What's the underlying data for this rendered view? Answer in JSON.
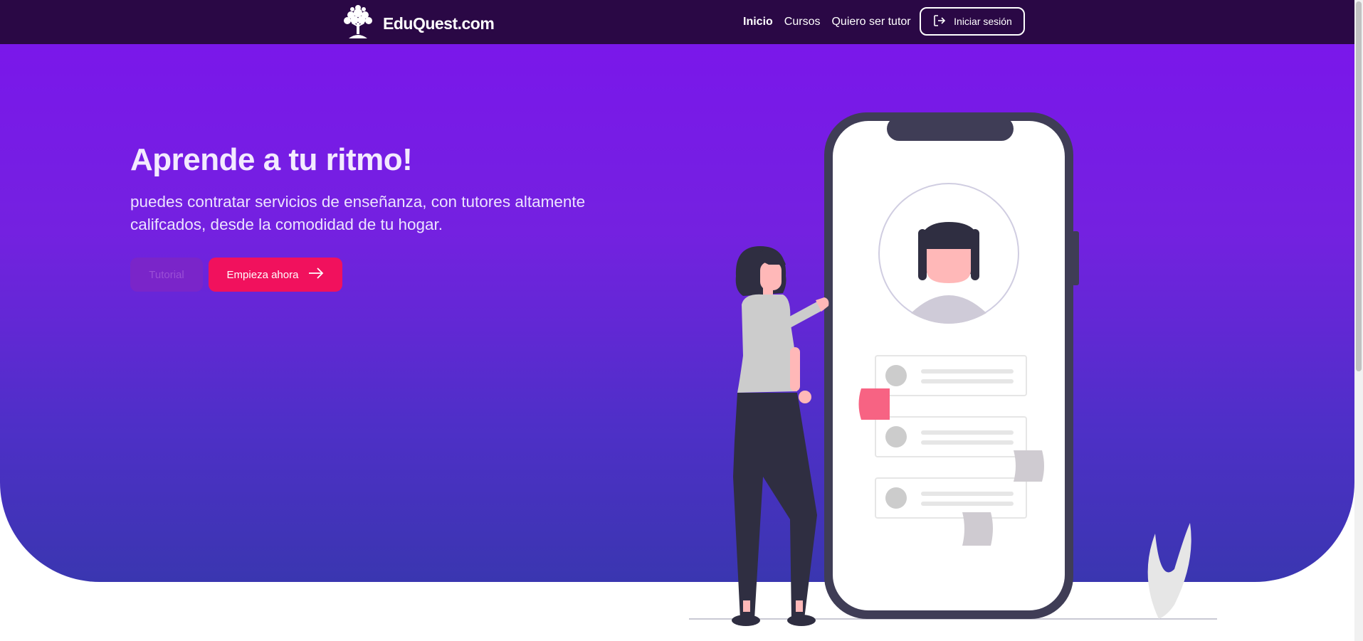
{
  "nav": {
    "brand": "EduQuest.com",
    "links": [
      "Inicio",
      "Cursos",
      "Quiero ser tutor"
    ],
    "login_label": "Iniciar sesión"
  },
  "hero": {
    "title": "Aprende a tu ritmo!",
    "description": "puedes contratar servicios de enseñanza, con tutores altamente califcados, desde la comodidad de tu hogar.",
    "tutorial_label": "Tutorial",
    "start_label": "Empieza ahora"
  },
  "colors": {
    "navbar": "#2a0845",
    "hero_top": "#7a17ea",
    "hero_bottom": "#3a36b0",
    "accent": "#f1115d"
  }
}
